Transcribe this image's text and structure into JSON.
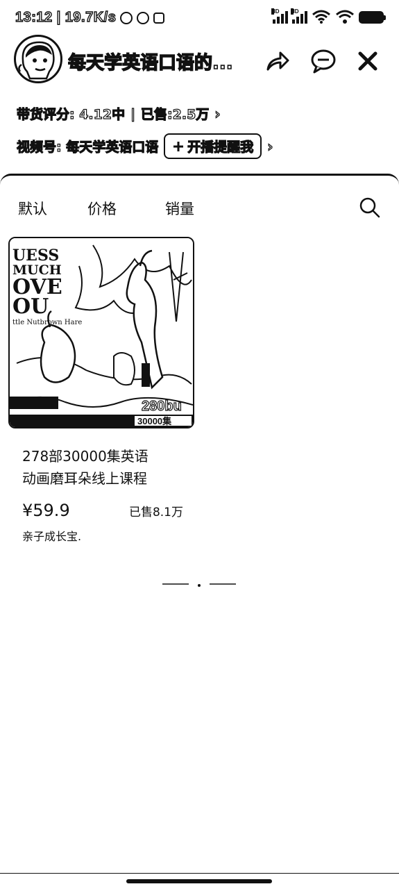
{
  "status_bar": {
    "time": "13:12",
    "net_speed": "19.7K/s",
    "icons": [
      "alarm-icon",
      "notification-icon",
      "app-icon",
      "signal-icon",
      "signal-icon",
      "wifi-icon",
      "battery-icon"
    ]
  },
  "header": {
    "channel_name": "每天学英语口语的...",
    "rating": "带货评分: 4.12中",
    "sold": "已售:2.5万",
    "video_account": "视频号: 每天学英语口语",
    "remind_button": "开播提醒我"
  },
  "sort_tabs": [
    {
      "label": "默认"
    },
    {
      "label": "价格"
    },
    {
      "label": "销量"
    }
  ],
  "product": {
    "image_text": {
      "line1": "UESS",
      "line2": "MUCH",
      "line3": "OVE",
      "line4": "OU",
      "line5": "ttle Nutbrown Hare",
      "count": "280bu",
      "bottom": "30000集"
    },
    "title_line1": "278部30000集英语",
    "title_line2": "动画磨耳朵线上课程",
    "price": "¥59.9",
    "sold": "已售8.1万",
    "shop": "亲子成长宝."
  }
}
